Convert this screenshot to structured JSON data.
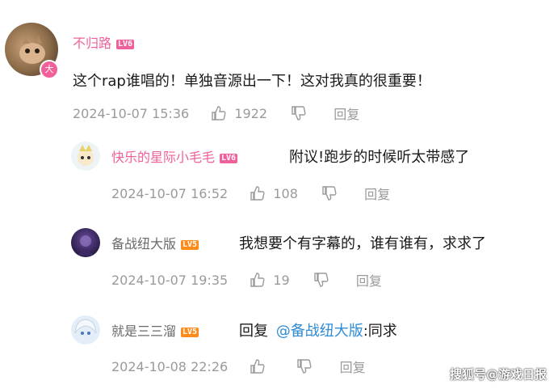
{
  "comments": [
    {
      "name": "不归路",
      "level": "LV6",
      "text": "这个rap谁唱的！单独音源出一下！这对我真的很重要！",
      "time": "2024-10-07 15:36",
      "likes": "1922",
      "reply_label": "回复",
      "badge": "大"
    },
    {
      "name": "快乐的星际小毛毛",
      "level": "LV6",
      "text": "附议!跑步的时候听太带感了",
      "time": "2024-10-07 16:52",
      "likes": "108",
      "reply_label": "回复"
    },
    {
      "name": "备战纽大版",
      "level": "LV5",
      "text": "我想要个有字幕的，谁有谁有，求求了",
      "time": "2024-10-07 19:35",
      "likes": "19",
      "reply_label": "回复"
    },
    {
      "name": "就是三三溜",
      "level": "LV5",
      "text_prefix": "回复",
      "mention": "@备战纽大版",
      "text_suffix": ":同求",
      "time": "2024-10-08 22:26",
      "likes": "",
      "reply_label": "回复"
    }
  ],
  "watermark": "搜狐号@游戏日报",
  "colors": {
    "name_pink": "#f0609a",
    "name_gray": "#6a6a6a",
    "lv6": "#f0609a",
    "lv5": "#ff8c1a",
    "meta": "#9a9a9a",
    "mention": "#2e8cd6"
  },
  "icons": {
    "like": "thumbs-up-icon",
    "dislike": "thumbs-down-icon"
  }
}
